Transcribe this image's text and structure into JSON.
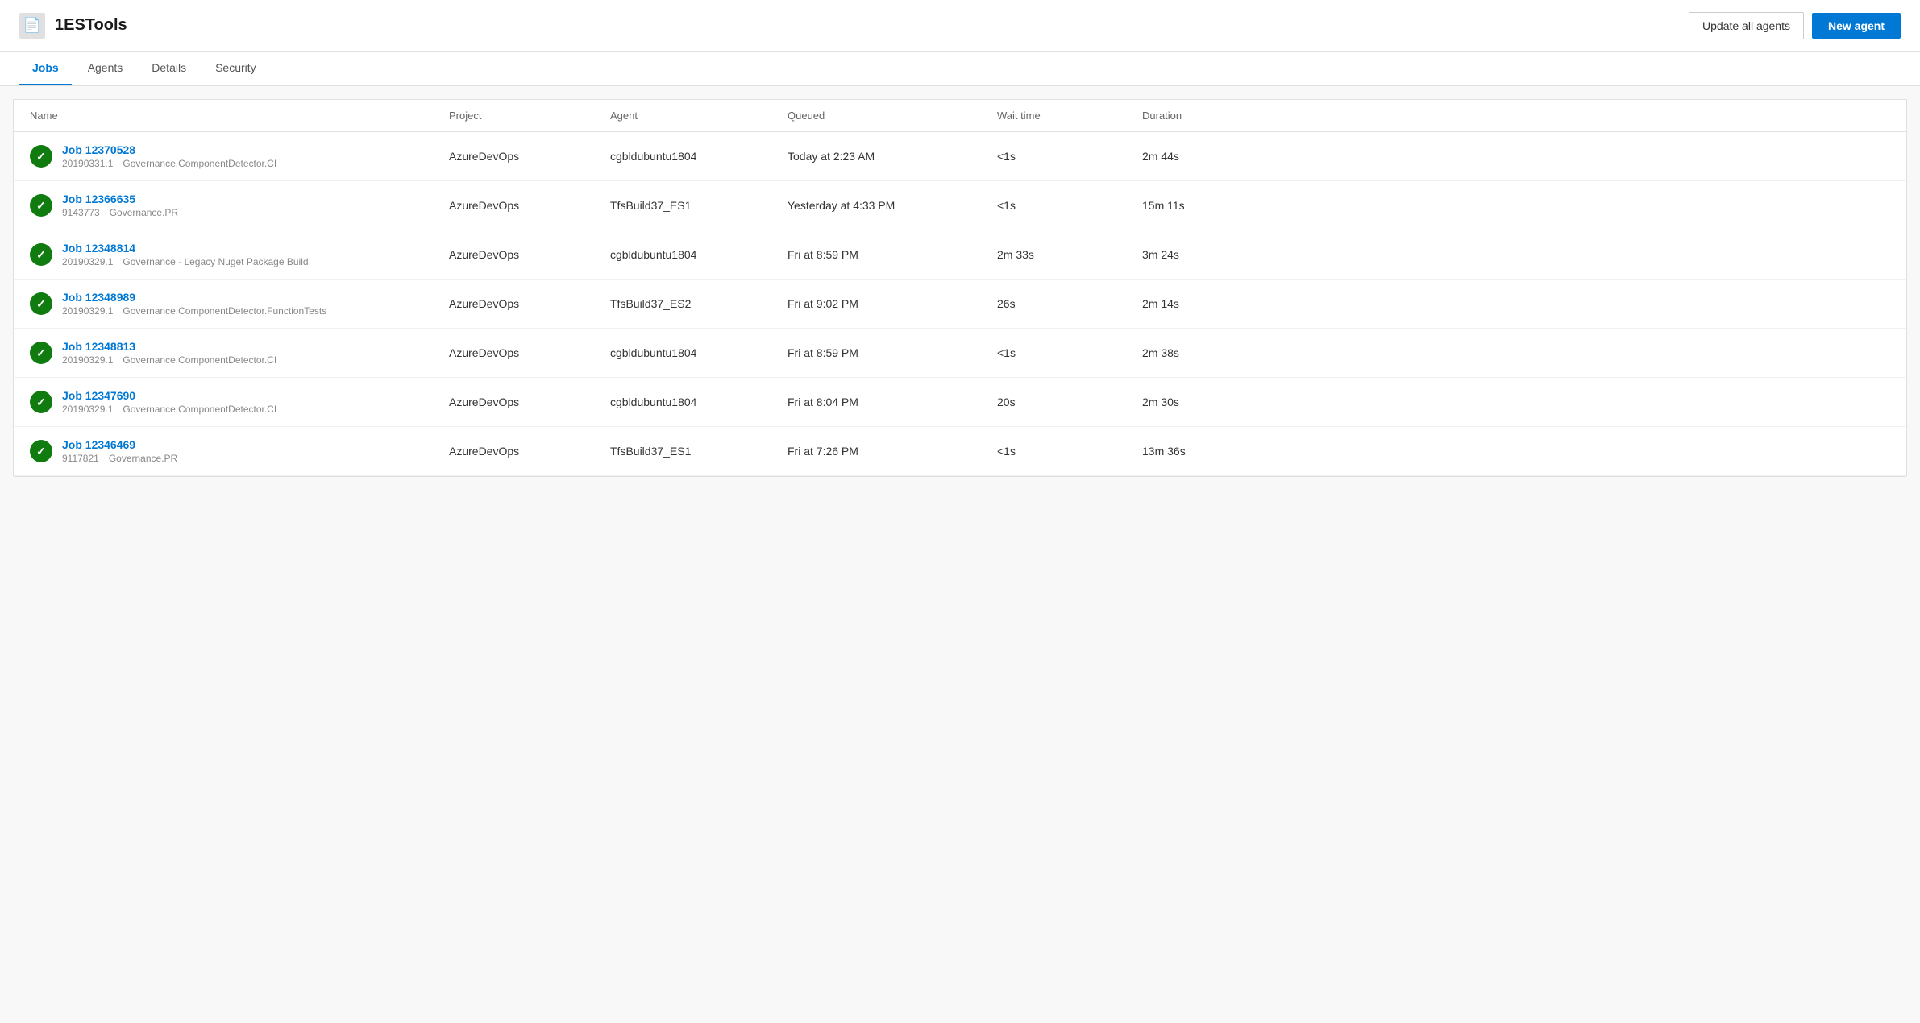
{
  "header": {
    "icon": "📄",
    "title": "1ESTools",
    "update_all_label": "Update all agents",
    "new_agent_label": "New agent"
  },
  "tabs": [
    {
      "id": "jobs",
      "label": "Jobs",
      "active": true
    },
    {
      "id": "agents",
      "label": "Agents",
      "active": false
    },
    {
      "id": "details",
      "label": "Details",
      "active": false
    },
    {
      "id": "security",
      "label": "Security",
      "active": false
    }
  ],
  "table": {
    "columns": [
      "Name",
      "Project",
      "Agent",
      "Queued",
      "Wait time",
      "Duration"
    ],
    "rows": [
      {
        "job_id": "Job 12370528",
        "build": "20190331.1",
        "pipeline": "Governance.ComponentDetector.CI",
        "project": "AzureDevOps",
        "agent": "cgbldubuntu1804",
        "queued": "Today at 2:23 AM",
        "wait_time": "<1s",
        "duration": "2m 44s",
        "status": "success"
      },
      {
        "job_id": "Job 12366635",
        "build": "9143773",
        "pipeline": "Governance.PR",
        "project": "AzureDevOps",
        "agent": "TfsBuild37_ES1",
        "queued": "Yesterday at 4:33 PM",
        "wait_time": "<1s",
        "duration": "15m 11s",
        "status": "success"
      },
      {
        "job_id": "Job 12348814",
        "build": "20190329.1",
        "pipeline": "Governance - Legacy Nuget Package Build",
        "project": "AzureDevOps",
        "agent": "cgbldubuntu1804",
        "queued": "Fri at 8:59 PM",
        "wait_time": "2m 33s",
        "duration": "3m 24s",
        "status": "success"
      },
      {
        "job_id": "Job 12348989",
        "build": "20190329.1",
        "pipeline": "Governance.ComponentDetector.FunctionTests",
        "project": "AzureDevOps",
        "agent": "TfsBuild37_ES2",
        "queued": "Fri at 9:02 PM",
        "wait_time": "26s",
        "duration": "2m 14s",
        "status": "success"
      },
      {
        "job_id": "Job 12348813",
        "build": "20190329.1",
        "pipeline": "Governance.ComponentDetector.CI",
        "project": "AzureDevOps",
        "agent": "cgbldubuntu1804",
        "queued": "Fri at 8:59 PM",
        "wait_time": "<1s",
        "duration": "2m 38s",
        "status": "success"
      },
      {
        "job_id": "Job 12347690",
        "build": "20190329.1",
        "pipeline": "Governance.ComponentDetector.CI",
        "project": "AzureDevOps",
        "agent": "cgbldubuntu1804",
        "queued": "Fri at 8:04 PM",
        "wait_time": "20s",
        "duration": "2m 30s",
        "status": "success"
      },
      {
        "job_id": "Job 12346469",
        "build": "9117821",
        "pipeline": "Governance.PR",
        "project": "AzureDevOps",
        "agent": "TfsBuild37_ES1",
        "queued": "Fri at 7:26 PM",
        "wait_time": "<1s",
        "duration": "13m 36s",
        "status": "success"
      }
    ]
  }
}
